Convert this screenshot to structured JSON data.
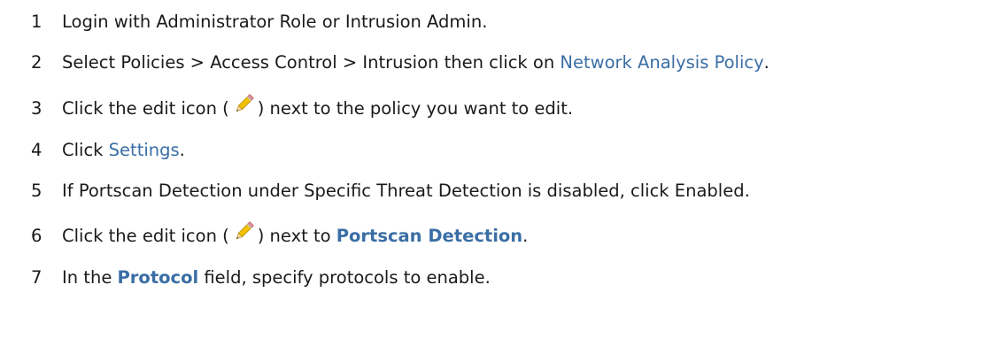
{
  "steps": [
    {
      "number": "1",
      "text": "Login with Administrator Role or Intrusion Admin."
    },
    {
      "number": "2",
      "prefix": "Select Policies > Access Control > Intrusion then click on ",
      "link": "Network Analysis Policy",
      "suffix": "."
    },
    {
      "number": "3",
      "prefix": "Click the edit icon (",
      "icon": "pencil-icon",
      "suffix": ") next to the policy you want to edit."
    },
    {
      "number": "4",
      "prefix": "Click ",
      "link": "Settings",
      "suffix": "."
    },
    {
      "number": "5",
      "text": "If Portscan Detection under Specific Threat Detection is disabled, click Enabled."
    },
    {
      "number": "6",
      "prefix": "Click the edit icon (",
      "icon": "pencil-icon",
      "middle": ") next to ",
      "link": "Portscan Detection",
      "suffix": "."
    },
    {
      "number": "7",
      "prefix": "In the ",
      "link": "Protocol",
      "suffix": " field, specify protocols to enable."
    }
  ],
  "colors": {
    "text": "#1a1a1a",
    "link": "#3a6ea5"
  }
}
